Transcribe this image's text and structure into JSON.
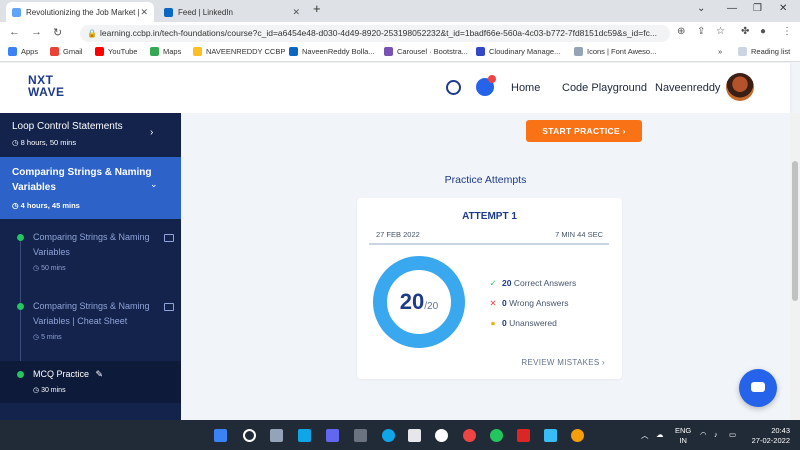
{
  "browser": {
    "tabs": [
      {
        "title": "Revolutionizing the Job Market |",
        "active": true
      },
      {
        "title": "Feed | LinkedIn",
        "active": false
      }
    ],
    "new_tab_glyph": "+",
    "url": "learning.ccbp.in/tech-foundations/course?c_id=a6454e48-d030-4d49-8920-253198052232&t_id=1badf66e-560a-4c03-b772-7fd8151dc59&s_id=fc...",
    "bookmarks": [
      "Apps",
      "Gmail",
      "YouTube",
      "Maps",
      "NAVEENREDDY CCBP",
      "NaveenReddy Bolla...",
      "Carousel · Bootstra...",
      "Cloudinary Manage...",
      "Icons | Font Aweso..."
    ],
    "more_bookmarks": "»",
    "reading_list": "Reading list"
  },
  "header": {
    "logo_line1": "NXT",
    "logo_line2": "WAVE",
    "nav": [
      "Home",
      "Code Playground"
    ],
    "username": "Naveenreddy"
  },
  "sidebar": {
    "loop": {
      "title": "Loop Control Statements",
      "meta": "8 hours, 50 mins"
    },
    "current": {
      "title_line1": "Comparing Strings & Naming",
      "title_line2": "Variables",
      "meta": "4 hours, 45 mins"
    },
    "items": [
      {
        "line1": "Comparing Strings & Naming",
        "line2": "Variables",
        "time": "50 mins"
      },
      {
        "line1": "Comparing Strings & Naming",
        "line2": "Variables | Cheat Sheet",
        "time": "5 mins"
      },
      {
        "line1": "MCQ Practice",
        "line2": "",
        "time": "30 mins"
      }
    ]
  },
  "main": {
    "start_button": "START PRACTICE",
    "attempts_heading": "Practice Attempts",
    "attempt": {
      "title": "ATTEMPT 1",
      "date": "27 FEB 2022",
      "duration": "7 MIN 44 SEC",
      "score": "20",
      "total": "/20",
      "score_fraction": 1.0,
      "correct_count": "20",
      "correct_label": "Correct Answers",
      "wrong_count": "0",
      "wrong_label": "Wrong Answers",
      "unanswered_count": "0",
      "unanswered_label": "Unanswered",
      "review": "REVIEW MISTAKES"
    }
  },
  "taskbar": {
    "lang_line1": "ENG",
    "lang_line2": "IN",
    "time": "20:43",
    "date": "27-02-2022"
  },
  "colors": {
    "accent": "#2563eb",
    "ring": "#3aa8ef",
    "orange": "#f97316",
    "sidebar_bg": "#13234b",
    "sidebar_active": "#2d63c8",
    "success": "#22c55e",
    "error": "#ef4444",
    "warning": "#eab308"
  }
}
